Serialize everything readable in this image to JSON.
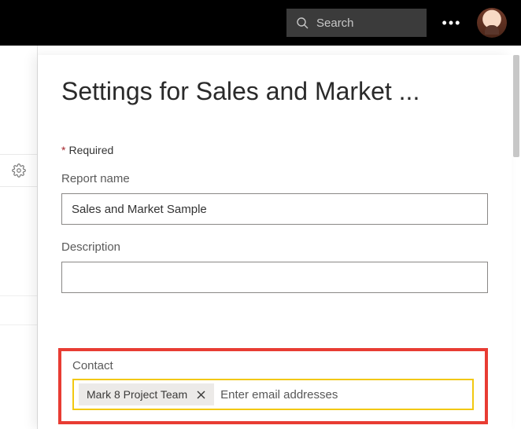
{
  "topbar": {
    "search_placeholder": "Search",
    "more_label": "•••"
  },
  "panel": {
    "title": "Settings for Sales and Market ...",
    "required_label": "Required"
  },
  "fields": {
    "report_name": {
      "label": "Report name",
      "value": "Sales and Market Sample"
    },
    "description": {
      "label": "Description",
      "value": ""
    },
    "contact": {
      "label": "Contact",
      "chip": "Mark 8 Project Team",
      "placeholder": "Enter email addresses"
    }
  }
}
